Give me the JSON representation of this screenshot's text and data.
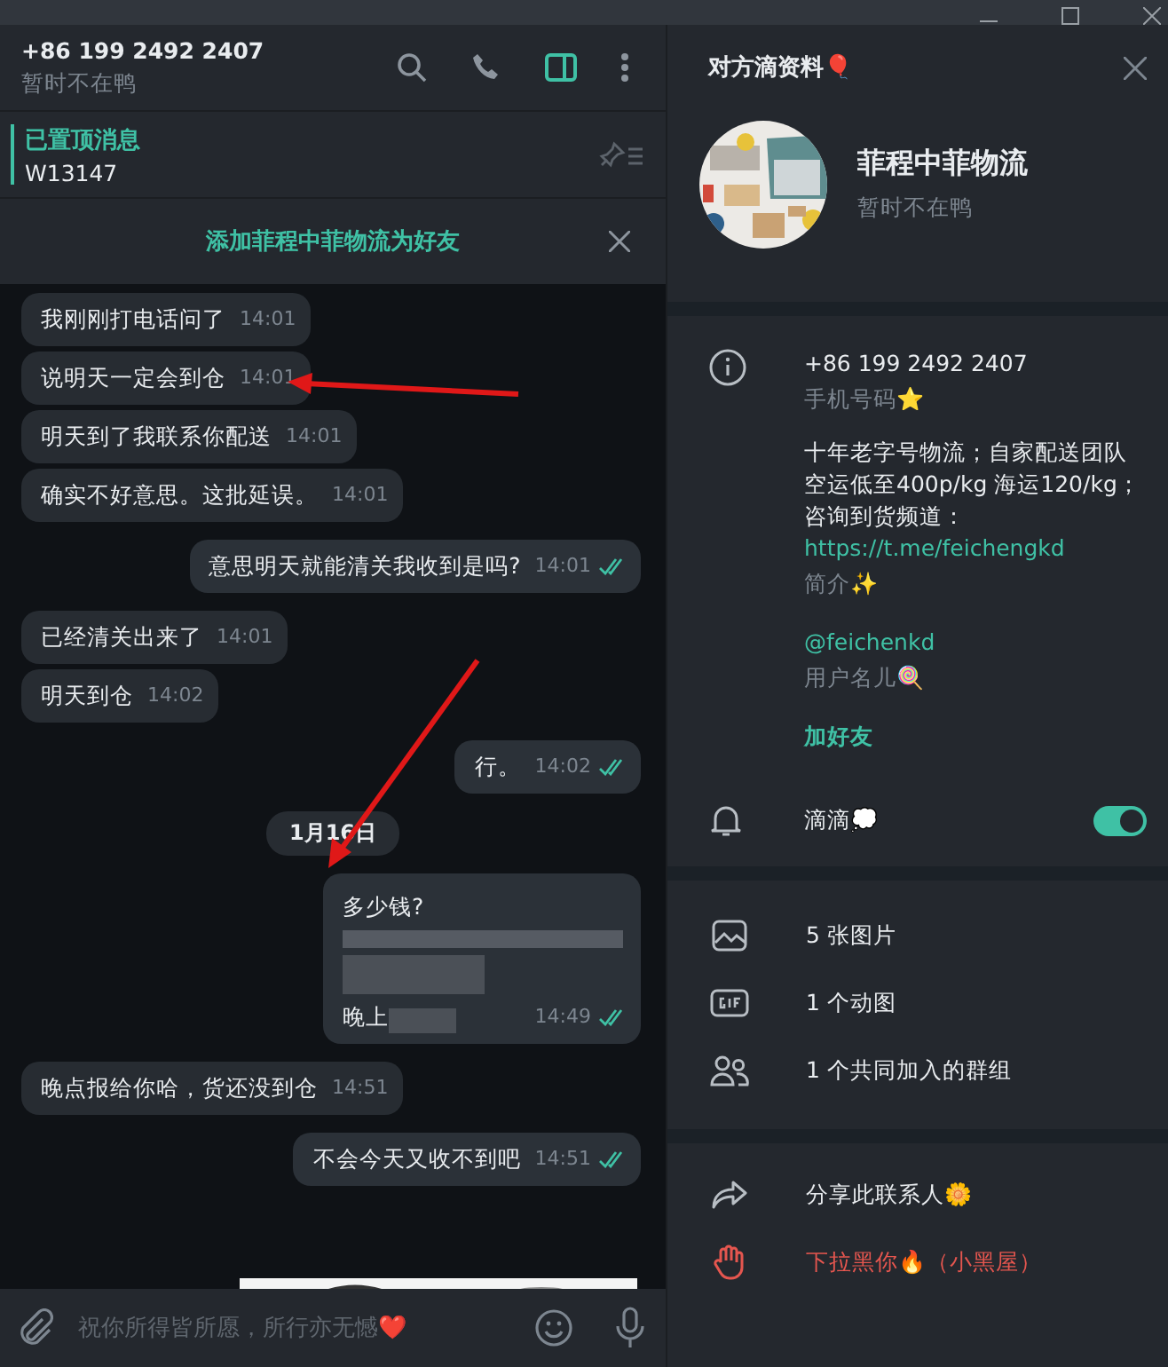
{
  "chat": {
    "title": "+86 199 2492 2407",
    "status": "暂时不在鸭"
  },
  "pinned": {
    "label": "已置顶消息",
    "text": "W13147"
  },
  "add_contact_bar": {
    "label": "添加菲程中菲物流为好友"
  },
  "messages": [
    {
      "kind": "incoming",
      "text": "我刚刚打电话问了",
      "time": "14:01"
    },
    {
      "kind": "incoming",
      "text": "说明天一定会到仓",
      "time": "14:01"
    },
    {
      "kind": "incoming",
      "text": "明天到了我联系你配送",
      "time": "14:01"
    },
    {
      "kind": "incoming",
      "text": "确实不好意思。这批延误。",
      "time": "14:01"
    },
    {
      "kind": "outgoing",
      "text": "意思明天就能清关我收到是吗?",
      "time": "14:01",
      "read": true
    },
    {
      "kind": "incoming",
      "text": "已经清关出来了",
      "time": "14:01"
    },
    {
      "kind": "incoming",
      "text": "明天到仓",
      "time": "14:02"
    },
    {
      "kind": "outgoing",
      "text": "行。",
      "time": "14:02",
      "read": true
    },
    {
      "kind": "date",
      "text": "1月16日"
    },
    {
      "kind": "outgoing",
      "text": "多少钱?",
      "blurred": true,
      "text_after": "晚上",
      "time": "14:49",
      "read": true
    },
    {
      "kind": "incoming",
      "text": "晚点报给你哈，货还没到仓",
      "time": "14:51"
    },
    {
      "kind": "outgoing",
      "text": "不会今天又收不到吧",
      "time": "14:51",
      "read": true
    },
    {
      "kind": "picture"
    }
  ],
  "composer": {
    "placeholder": "祝你所得皆所愿，所行亦无憾❤️"
  },
  "profile": {
    "title": "对方滴资料🎈",
    "name": "菲程中菲物流",
    "status": "暂时不在鸭"
  },
  "info": {
    "phone": "+86 199 2492 2407",
    "phone_label": "手机号码⭐",
    "bio_lines": [
      "十年老字号物流；自家配送团队",
      "空运低至400p/kg 海运120/kg；",
      "咨询到货频道："
    ],
    "link": "https://t.me/feichengkd",
    "bio_label": "简介✨",
    "username": "@feichenkd",
    "username_label": "用户名儿🍭",
    "add_friend": "加好友"
  },
  "notifications": {
    "label": "滴滴💭",
    "on": true
  },
  "media": [
    {
      "kind": "photos",
      "label": "5 张图片"
    },
    {
      "kind": "gifs",
      "label": "1 个动图"
    },
    {
      "kind": "groups",
      "label": "1 个共同加入的群组"
    }
  ],
  "actions": [
    {
      "kind": "share",
      "label": "分享此联系人🌼"
    },
    {
      "kind": "block",
      "label": "下拉黑你🔥（小黑屋）"
    }
  ]
}
